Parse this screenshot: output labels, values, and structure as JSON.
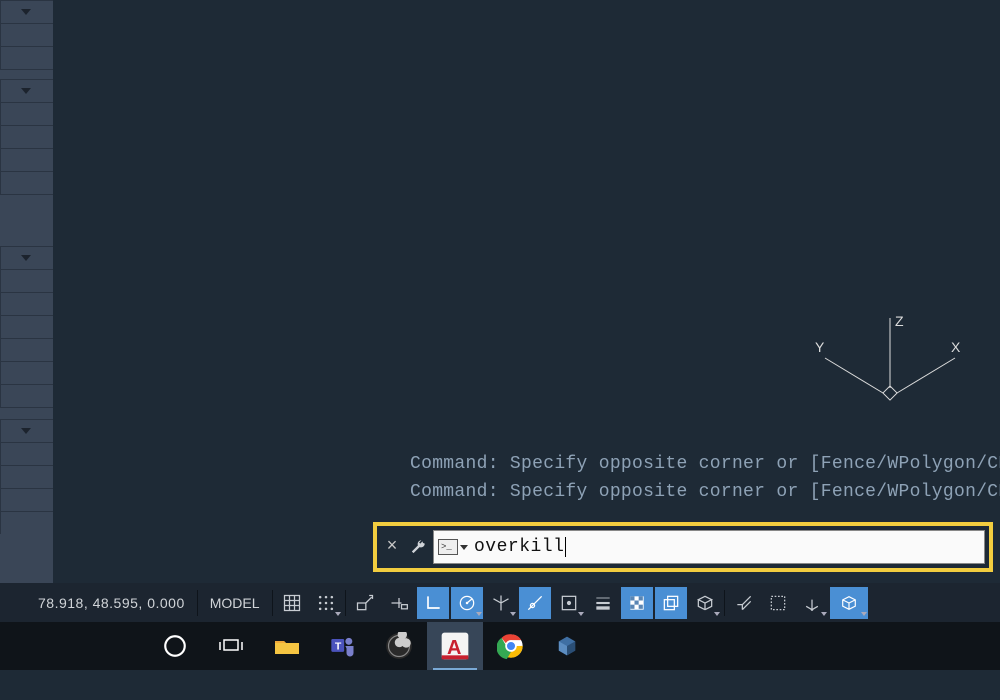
{
  "ucs": {
    "x_label": "X",
    "y_label": "Y",
    "z_label": "Z"
  },
  "command_history": {
    "line1": "Command: Specify opposite corner or [Fence/WPolygon/CPolyg",
    "line2": "Command: Specify opposite corner or [Fence/WPolygon/CPolyg"
  },
  "command_line": {
    "prompt_glyph": ">_",
    "value": "overkill"
  },
  "statusbar": {
    "coords": "78.918, 48.595, 0.000",
    "model_label": "MODEL"
  },
  "status_buttons": [
    {
      "name": "grid-display",
      "active": false
    },
    {
      "name": "snap-mode",
      "active": false
    },
    {
      "name": "infer-constraints",
      "active": false
    },
    {
      "name": "dynamic-input",
      "active": false
    },
    {
      "name": "ortho-mode",
      "active": true
    },
    {
      "name": "polar-tracking",
      "active": true
    },
    {
      "name": "isometric-drafting",
      "active": false
    },
    {
      "name": "object-snap-track",
      "active": true
    },
    {
      "name": "2d-osnap",
      "active": false
    },
    {
      "name": "lineweight",
      "active": false
    },
    {
      "name": "transparency",
      "active": true
    },
    {
      "name": "selection-cycling",
      "active": true
    },
    {
      "name": "3d-osnap",
      "active": false
    },
    {
      "name": "dynamic-ucs",
      "active": false
    },
    {
      "name": "selection-filter",
      "active": false
    },
    {
      "name": "gizmo",
      "active": false
    },
    {
      "name": "visual-style",
      "active": true
    }
  ],
  "taskbar": {
    "items": [
      {
        "name": "cortana",
        "active": false
      },
      {
        "name": "task-view",
        "active": false
      },
      {
        "name": "file-explorer",
        "active": false
      },
      {
        "name": "teams",
        "active": false
      },
      {
        "name": "obs",
        "active": false
      },
      {
        "name": "autocad",
        "active": true
      },
      {
        "name": "chrome",
        "active": false
      },
      {
        "name": "autodesk-app",
        "active": false
      }
    ]
  },
  "colors": {
    "highlight": "#f2cd3f",
    "active_button": "#4a8fd4",
    "canvas": "#1e2a36"
  }
}
